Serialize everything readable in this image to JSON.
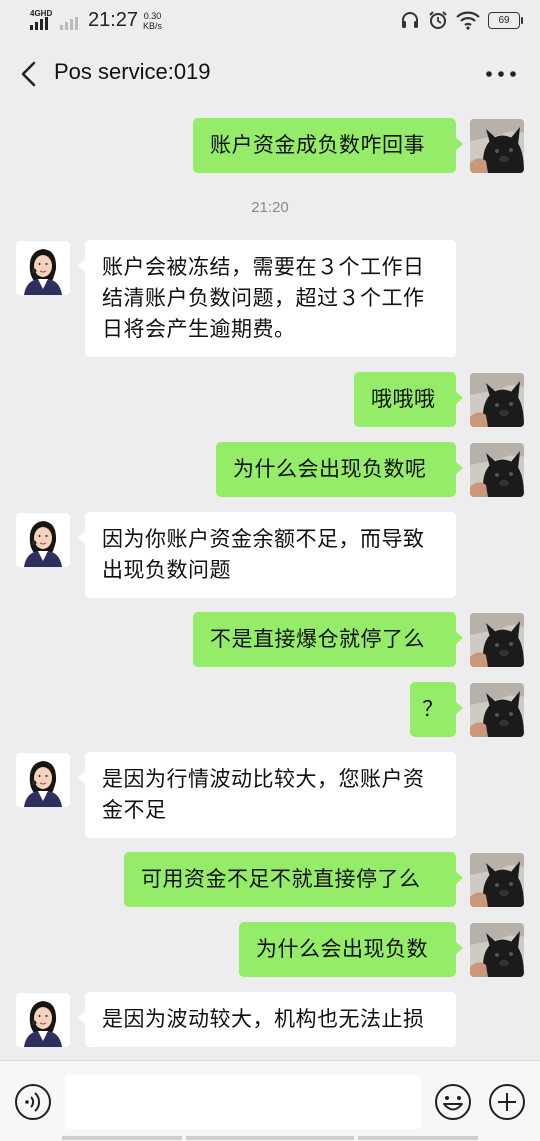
{
  "status_bar": {
    "network": "4GHD",
    "time": "21:27",
    "speed_value": "0.30",
    "speed_unit": "KB/s",
    "battery": "69",
    "icons": [
      "signal-icon",
      "headphone-icon",
      "alarm-icon",
      "wifi-icon",
      "battery-icon"
    ]
  },
  "header": {
    "title": "Pos service:019",
    "back_icon": "back-arrow-icon",
    "more_icon": "more-dots-icon"
  },
  "messages": [
    {
      "from": "me",
      "text": "账户资金成负数咋回事"
    },
    {
      "type": "time",
      "text": "21:20"
    },
    {
      "from": "them",
      "lines": [
        "账户会被冻结，需要在３个工作日",
        "结清账户负数问题，超过３个工作",
        "日将会产生逾期费。"
      ]
    },
    {
      "from": "me",
      "text": "哦哦哦"
    },
    {
      "from": "me",
      "text": "为什么会出现负数呢"
    },
    {
      "from": "them",
      "lines": [
        "因为你账户资金余额不足，而导致",
        "出现负数问题"
      ]
    },
    {
      "from": "me",
      "text": "不是直接爆仓就停了么"
    },
    {
      "from": "me",
      "text": "？"
    },
    {
      "from": "them",
      "lines": [
        "是因为行情波动比较大，您账户资",
        "金不足"
      ]
    },
    {
      "from": "me",
      "text": "可用资金不足不就直接停了么"
    },
    {
      "from": "me",
      "text": "为什么会出现负数"
    },
    {
      "from": "them",
      "lines": [
        "是因为波动较大，机构也无法止损"
      ]
    }
  ],
  "input_bar": {
    "value": "",
    "icons": [
      "voice-icon",
      "emoji-icon",
      "plus-icon"
    ]
  },
  "colors": {
    "background": "#ededed",
    "my_bubble": "#95ec69",
    "their_bubble": "#ffffff",
    "timestamp": "#8a8a8a"
  }
}
